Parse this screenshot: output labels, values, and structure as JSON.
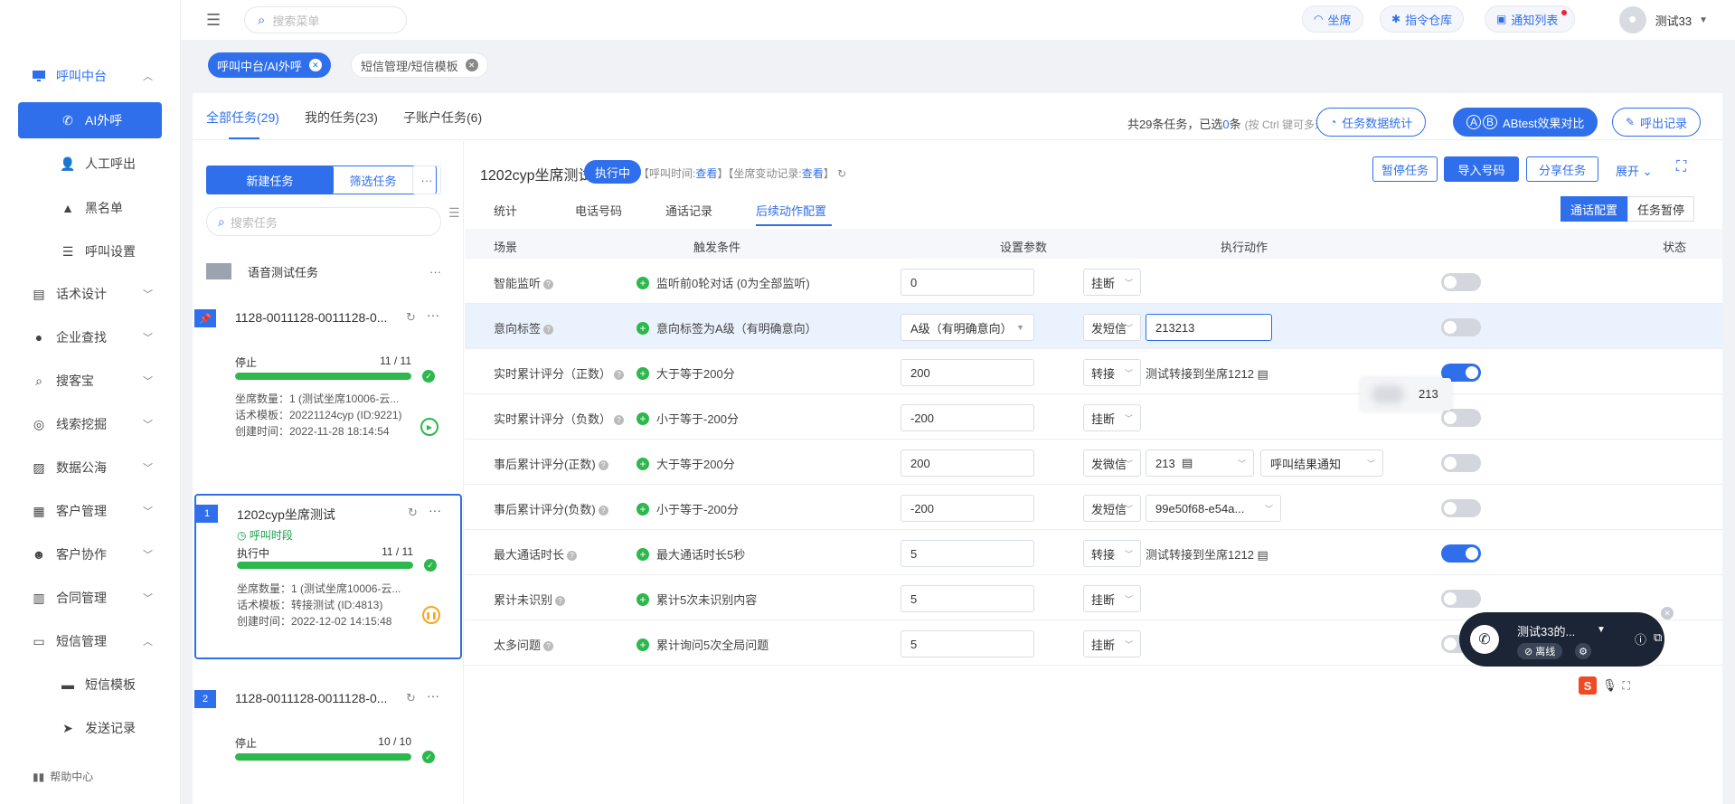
{
  "header": {
    "search_placeholder": "搜索菜单",
    "seat": "坐席",
    "instructions": "指令仓库",
    "notices": "通知列表",
    "username": "测试33"
  },
  "sidebar": {
    "items": [
      {
        "label": "呼叫中台"
      },
      {
        "label": "AI外呼"
      },
      {
        "label": "人工呼出"
      },
      {
        "label": "黑名单"
      },
      {
        "label": "呼叫设置"
      },
      {
        "label": "话术设计"
      },
      {
        "label": "企业查找"
      },
      {
        "label": "搜客宝"
      },
      {
        "label": "线索挖掘"
      },
      {
        "label": "数据公海"
      },
      {
        "label": "客户管理"
      },
      {
        "label": "客户协作"
      },
      {
        "label": "合同管理"
      },
      {
        "label": "短信管理"
      },
      {
        "label": "短信模板"
      },
      {
        "label": "发送记录"
      }
    ],
    "help": "帮助中心"
  },
  "tags": [
    "呼叫中台/AI外呼",
    "短信管理/短信模板"
  ],
  "task_tabs": [
    "全部任务(29)",
    "我的任务(23)",
    "子账户任务(6)"
  ],
  "summary": {
    "prefix": "共29条任务，已选",
    "count": "0",
    "suffix": "条",
    "hint": "(按 Ctrl 键可多选)"
  },
  "top_buttons": {
    "stats": "任务数据统计",
    "abtest": "ABtest效果对比",
    "ab_a": "A",
    "ab_b": "B",
    "records": "呼出记录"
  },
  "task_panel": {
    "new": "新建任务",
    "filter": "筛选任务",
    "more": "···",
    "search_placeholder": "搜索任务",
    "group": "语音测试任务",
    "group_dots": "···"
  },
  "tasks": [
    {
      "badge": "",
      "title": "1128-0011128-0011128-0...",
      "phase": "",
      "status": "停止",
      "count": "11 / 11",
      "progress": 1.0,
      "seats": "坐席数量：1 (测试坐席10006-云...",
      "template": "话术模板：20221124cyp (ID:9221)",
      "created": "创建时间：2022-11-28 18:14:54",
      "action": "play"
    },
    {
      "badge": "1",
      "title": "1202cyp坐席测试",
      "phase": "呼叫时段",
      "status": "执行中",
      "count": "11 / 11",
      "progress": 1.0,
      "seats": "坐席数量：1 (测试坐席10006-云...",
      "template": "话术模板：转接测试 (ID:4813)",
      "created": "创建时间：2022-12-02 14:15:48",
      "action": "pause"
    },
    {
      "badge": "2",
      "title": "1128-0011128-0011128-0...",
      "phase": "",
      "status": "停止",
      "count": "10 / 10",
      "progress": 1.0,
      "seats": "",
      "template": "",
      "created": "",
      "action": ""
    }
  ],
  "detail": {
    "title": "1202cyp坐席测试",
    "status": "执行中",
    "meta": {
      "call_time": "【呼叫时间:",
      "view1": "查看",
      "mid": "】【坐席变动记录:",
      "view2": "查看",
      "end": "】"
    },
    "buttons": {
      "pause": "暂停任务",
      "import": "导入号码",
      "share": "分享任务",
      "expand": "展开"
    },
    "tabs": [
      "统计",
      "电话号码",
      "通话记录",
      "后续动作配置"
    ],
    "seg": [
      "通话配置",
      "任务暂停"
    ],
    "columns": [
      "场景",
      "触发条件",
      "设置参数",
      "执行动作",
      "状态"
    ],
    "rows": [
      {
        "scene": "智能监听",
        "trigger": "监听前0轮对话 (0为全部监听)",
        "param": "0",
        "action": "挂断",
        "extra": "",
        "on": false
      },
      {
        "scene": "意向标签",
        "trigger": "意向标签为A级（有明确意向）",
        "param": "A级（有明确意向）",
        "action": "发短信",
        "extra": "213213",
        "extra_tail": "213",
        "on": false
      },
      {
        "scene": "实时累计评分（正数）",
        "trigger": "大于等于200分",
        "param": "200",
        "action": "转接",
        "extra": "测试转接到坐席1212",
        "on": true
      },
      {
        "scene": "实时累计评分（负数）",
        "trigger": "小于等于-200分",
        "param": "-200",
        "action": "挂断",
        "extra": "",
        "on": false
      },
      {
        "scene": "事后累计评分(正数)",
        "trigger": "大于等于200分",
        "param": "200",
        "action": "发微信",
        "extra": "213",
        "extra2": "呼叫结果通知",
        "on": false
      },
      {
        "scene": "事后累计评分(负数)",
        "trigger": "小于等于-200分",
        "param": "-200",
        "action": "发短信",
        "extra": "99e50f68-e54a...",
        "on": false
      },
      {
        "scene": "最大通话时长",
        "trigger": "最大通话时长5秒",
        "param": "5",
        "action": "转接",
        "extra": "测试转接到坐席1212",
        "on": true
      },
      {
        "scene": "累计未识别",
        "trigger": "累计5次未识别内容",
        "param": "5",
        "action": "挂断",
        "extra": "",
        "on": false
      },
      {
        "scene": "太多问题",
        "trigger": "累计询问5次全局问题",
        "param": "5",
        "action": "挂断",
        "extra": "",
        "on": false
      }
    ]
  },
  "call_widget": {
    "name": "测试33的...",
    "status": "离线"
  },
  "ime": {
    "logo": "S"
  }
}
